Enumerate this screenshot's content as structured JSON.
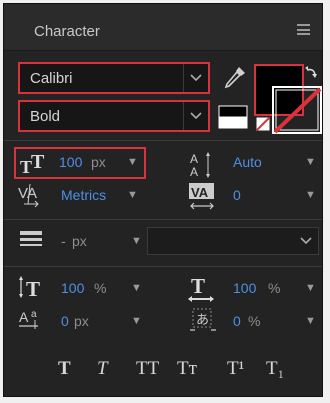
{
  "panel": {
    "title": "Character"
  },
  "font": {
    "family": "Calibri",
    "style": "Bold"
  },
  "size": {
    "value": "100",
    "unit": "px"
  },
  "leading": {
    "value": "Auto"
  },
  "kerning": {
    "value": "Metrics"
  },
  "tracking": {
    "value": "0"
  },
  "stroke": {
    "value": "-",
    "unit": "px"
  },
  "vertical_scale": {
    "value": "100",
    "unit": "%"
  },
  "horizontal_scale": {
    "value": "100",
    "unit": "%"
  },
  "baseline_shift": {
    "value": "0",
    "unit": "px"
  },
  "tsume": {
    "value": "0",
    "unit": "%"
  },
  "type_styles": {
    "faux_bold": "T",
    "faux_italic": "T",
    "all_caps": "TT",
    "small_caps": "Tт",
    "superscript": "T¹",
    "subscript": "T₁"
  },
  "colors": {
    "fill": "#000000",
    "highlight": "#d9323a",
    "accent": "#4e8fe5"
  }
}
